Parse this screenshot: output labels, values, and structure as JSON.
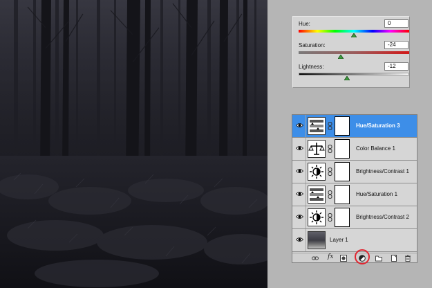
{
  "adjustments": {
    "hue": {
      "label": "Hue:",
      "value": "0",
      "level": 0.5
    },
    "saturation": {
      "label": "Saturation:",
      "value": "-24",
      "level": 0.38
    },
    "lightness": {
      "label": "Lightness:",
      "value": "-12",
      "level": 0.44
    }
  },
  "layers": [
    {
      "name": "Hue/Saturation 3",
      "kind": "hue-saturation",
      "selected": true
    },
    {
      "name": "Color Balance 1",
      "kind": "color-balance",
      "selected": false
    },
    {
      "name": "Brightness/Contrast 1",
      "kind": "brightness-contrast",
      "selected": false
    },
    {
      "name": "Hue/Saturation 1",
      "kind": "hue-saturation",
      "selected": false
    },
    {
      "name": "Brightness/Contrast 2",
      "kind": "brightness-contrast",
      "selected": false
    },
    {
      "name": "Layer 1",
      "kind": "photo",
      "selected": false
    }
  ],
  "toolbar": {
    "fx_label": "fx",
    "icons": [
      "link-icon",
      "fx-icon",
      "mask-icon",
      "adjustment-icon",
      "group-icon",
      "new-layer-icon",
      "trash-icon"
    ]
  },
  "colors": {
    "selection": "#3d8ee8",
    "highlight_ring": "#e0242f"
  }
}
